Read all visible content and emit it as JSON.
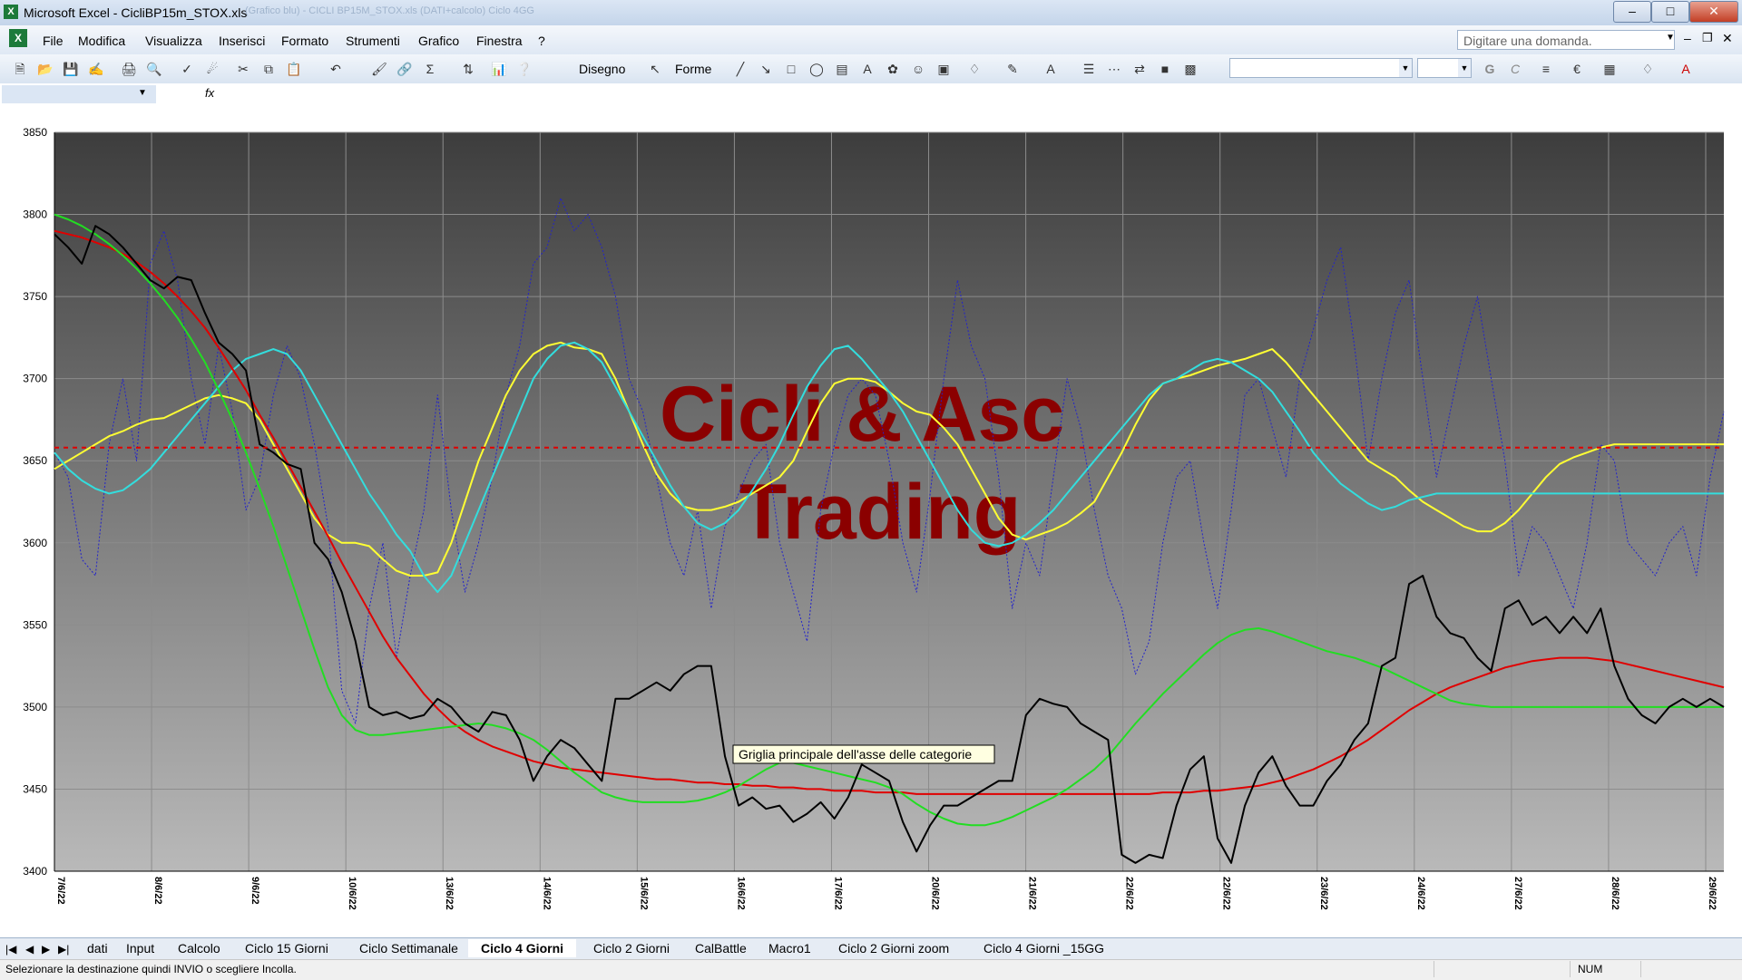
{
  "window": {
    "app_icon": "excel-icon",
    "title": "Microsoft Excel - CicliBP15m_STOX.xls",
    "blurred_text": "(Grafico blu) - CICLI BP15M_STOX.xls (DATI+calcolo) Ciclo 4GG"
  },
  "menu": [
    "File",
    "Modifica",
    "Visualizza",
    "Inserisci",
    "Formato",
    "Strumenti",
    "Grafico",
    "Finestra",
    "?"
  ],
  "ask_box": {
    "placeholder": "Digitare una domanda."
  },
  "toolbar": {
    "disegno_label": "Disegno",
    "forme_label": "Forme"
  },
  "chart_data": {
    "type": "line",
    "watermark": [
      "Cicli & Asc",
      "Trading"
    ],
    "ylim": [
      3400,
      3850
    ],
    "yticks": [
      3400,
      3450,
      3500,
      3550,
      3600,
      3650,
      3700,
      3750,
      3800,
      3850
    ],
    "x_labels": [
      "7/6/22",
      "8/6/22",
      "9/6/22",
      "10/6/22",
      "13/6/22",
      "14/6/22",
      "15/6/22",
      "16/6/22",
      "17/6/22",
      "20/6/22",
      "21/6/22",
      "22/6/22",
      "22/6/22",
      "23/6/22",
      "24/6/22",
      "27/6/22",
      "28/6/22",
      "29/6/22"
    ],
    "reference_line": {
      "value": 3658,
      "color": "#e00000",
      "style": "dashed"
    },
    "tooltip": "Griglia principale dell'asse delle categorie",
    "colors": {
      "price": "#000000",
      "red": "#e00000",
      "green": "#22dd22",
      "yellow": "#ffff33",
      "cyan": "#33dddd",
      "oscillator": "#2222cc"
    },
    "series": [
      {
        "key": "price",
        "values": [
          3788,
          3780,
          3770,
          3793,
          3788,
          3780,
          3770,
          3760,
          3755,
          3762,
          3760,
          3740,
          3722,
          3715,
          3705,
          3660,
          3655,
          3648,
          3645,
          3600,
          3590,
          3570,
          3540,
          3500,
          3495,
          3497,
          3493,
          3495,
          3505,
          3500,
          3490,
          3485,
          3497,
          3495,
          3480,
          3455,
          3470,
          3480,
          3475,
          3465,
          3455,
          3505,
          3505,
          3510,
          3515,
          3510,
          3520,
          3525,
          3525,
          3470,
          3440,
          3445,
          3438,
          3440,
          3430,
          3435,
          3442,
          3432,
          3445,
          3465,
          3460,
          3455,
          3430,
          3412,
          3428,
          3440,
          3440,
          3445,
          3450,
          3455,
          3455,
          3495,
          3505,
          3502,
          3500,
          3490,
          3485,
          3480,
          3410,
          3405,
          3410,
          3408,
          3440,
          3462,
          3470,
          3420,
          3405,
          3440,
          3460,
          3470,
          3452,
          3440,
          3440,
          3455,
          3465,
          3480,
          3490,
          3525,
          3530,
          3575,
          3580,
          3555,
          3545,
          3542,
          3530,
          3522,
          3560,
          3565,
          3550,
          3555,
          3545,
          3555,
          3545,
          3560,
          3525,
          3505,
          3495,
          3490,
          3500,
          3505,
          3500,
          3505,
          3500
        ]
      },
      {
        "key": "red",
        "values": [
          3790,
          3788,
          3786,
          3783,
          3780,
          3776,
          3771,
          3765,
          3758,
          3750,
          3741,
          3731,
          3719,
          3706,
          3693,
          3678,
          3664,
          3649,
          3634,
          3619,
          3604,
          3588,
          3573,
          3558,
          3543,
          3530,
          3519,
          3508,
          3499,
          3491,
          3485,
          3480,
          3476,
          3473,
          3470,
          3467,
          3465,
          3463,
          3462,
          3461,
          3460,
          3459,
          3458,
          3457,
          3456,
          3456,
          3455,
          3454,
          3454,
          3453,
          3453,
          3452,
          3452,
          3451,
          3451,
          3450,
          3450,
          3449,
          3449,
          3449,
          3448,
          3448,
          3448,
          3447,
          3447,
          3447,
          3447,
          3447,
          3447,
          3447,
          3447,
          3447,
          3447,
          3447,
          3447,
          3447,
          3447,
          3447,
          3447,
          3447,
          3447,
          3448,
          3448,
          3448,
          3449,
          3449,
          3450,
          3451,
          3452,
          3454,
          3456,
          3459,
          3462,
          3466,
          3470,
          3475,
          3480,
          3486,
          3492,
          3498,
          3503,
          3508,
          3512,
          3515,
          3518,
          3521,
          3524,
          3526,
          3528,
          3529,
          3530,
          3530,
          3530,
          3529,
          3528,
          3526,
          3524,
          3522,
          3520,
          3518,
          3516,
          3514,
          3512
        ]
      },
      {
        "key": "green",
        "values": [
          3800,
          3797,
          3793,
          3788,
          3782,
          3775,
          3767,
          3758,
          3748,
          3737,
          3724,
          3710,
          3693,
          3675,
          3655,
          3633,
          3610,
          3585,
          3560,
          3535,
          3512,
          3495,
          3486,
          3483,
          3483,
          3484,
          3485,
          3486,
          3487,
          3488,
          3489,
          3490,
          3489,
          3487,
          3484,
          3480,
          3474,
          3467,
          3460,
          3454,
          3448,
          3445,
          3443,
          3442,
          3442,
          3442,
          3442,
          3443,
          3445,
          3448,
          3452,
          3457,
          3462,
          3466,
          3466,
          3464,
          3462,
          3460,
          3458,
          3456,
          3454,
          3451,
          3447,
          3441,
          3436,
          3432,
          3429,
          3428,
          3428,
          3430,
          3433,
          3437,
          3441,
          3445,
          3450,
          3456,
          3462,
          3470,
          3480,
          3490,
          3499,
          3508,
          3516,
          3524,
          3532,
          3539,
          3544,
          3547,
          3548,
          3546,
          3543,
          3540,
          3537,
          3534,
          3532,
          3530,
          3527,
          3524,
          3520,
          3516,
          3512,
          3508,
          3504,
          3502,
          3501,
          3500,
          3500,
          3500,
          3500,
          3500,
          3500,
          3500,
          3500,
          3500,
          3500,
          3500,
          3500,
          3500,
          3500,
          3500,
          3500,
          3500,
          3500
        ]
      },
      {
        "key": "yellow",
        "values": [
          3645,
          3650,
          3655,
          3660,
          3665,
          3668,
          3672,
          3675,
          3676,
          3680,
          3684,
          3688,
          3690,
          3688,
          3685,
          3675,
          3660,
          3645,
          3630,
          3615,
          3605,
          3600,
          3600,
          3598,
          3590,
          3583,
          3580,
          3580,
          3582,
          3600,
          3625,
          3650,
          3670,
          3690,
          3705,
          3715,
          3720,
          3722,
          3719,
          3718,
          3715,
          3700,
          3680,
          3660,
          3642,
          3630,
          3622,
          3620,
          3620,
          3622,
          3625,
          3630,
          3635,
          3640,
          3650,
          3668,
          3685,
          3697,
          3700,
          3700,
          3698,
          3692,
          3685,
          3680,
          3678,
          3670,
          3660,
          3645,
          3630,
          3615,
          3605,
          3602,
          3605,
          3608,
          3612,
          3618,
          3625,
          3640,
          3655,
          3672,
          3687,
          3697,
          3700,
          3702,
          3705,
          3708,
          3710,
          3712,
          3715,
          3718,
          3710,
          3700,
          3690,
          3680,
          3670,
          3660,
          3650,
          3645,
          3640,
          3632,
          3625,
          3620,
          3615,
          3610,
          3607,
          3607,
          3612,
          3620,
          3630,
          3640,
          3648,
          3652,
          3655,
          3658,
          3660,
          3660,
          3660,
          3660,
          3660,
          3660,
          3660,
          3660,
          3660
        ]
      },
      {
        "key": "cyan",
        "values": [
          3655,
          3645,
          3638,
          3633,
          3630,
          3632,
          3638,
          3645,
          3655,
          3665,
          3675,
          3685,
          3695,
          3705,
          3712,
          3715,
          3718,
          3715,
          3705,
          3690,
          3675,
          3660,
          3645,
          3630,
          3618,
          3605,
          3595,
          3580,
          3570,
          3580,
          3600,
          3620,
          3640,
          3660,
          3680,
          3700,
          3712,
          3720,
          3722,
          3718,
          3710,
          3695,
          3680,
          3665,
          3650,
          3635,
          3622,
          3612,
          3608,
          3612,
          3620,
          3632,
          3645,
          3660,
          3678,
          3695,
          3708,
          3718,
          3720,
          3712,
          3702,
          3692,
          3680,
          3665,
          3650,
          3635,
          3620,
          3608,
          3600,
          3598,
          3600,
          3605,
          3612,
          3620,
          3630,
          3640,
          3650,
          3660,
          3670,
          3680,
          3690,
          3697,
          3700,
          3705,
          3710,
          3712,
          3710,
          3705,
          3700,
          3692,
          3680,
          3668,
          3655,
          3645,
          3636,
          3630,
          3624,
          3620,
          3622,
          3626,
          3628,
          3630,
          3630,
          3630,
          3630,
          3630,
          3630,
          3630,
          3630,
          3630,
          3630,
          3630,
          3630,
          3630,
          3630,
          3630,
          3630,
          3630,
          3630,
          3630,
          3630,
          3630,
          3630
        ]
      },
      {
        "key": "oscillator",
        "values": [
          3655,
          3640,
          3590,
          3580,
          3660,
          3700,
          3650,
          3770,
          3790,
          3760,
          3700,
          3660,
          3720,
          3680,
          3620,
          3640,
          3690,
          3720,
          3700,
          3660,
          3610,
          3510,
          3490,
          3560,
          3600,
          3530,
          3580,
          3620,
          3690,
          3620,
          3570,
          3600,
          3640,
          3690,
          3720,
          3770,
          3780,
          3810,
          3790,
          3800,
          3780,
          3750,
          3700,
          3680,
          3640,
          3600,
          3580,
          3620,
          3560,
          3610,
          3630,
          3650,
          3660,
          3600,
          3570,
          3540,
          3620,
          3660,
          3690,
          3700,
          3690,
          3650,
          3600,
          3570,
          3630,
          3700,
          3760,
          3720,
          3700,
          3640,
          3560,
          3600,
          3580,
          3640,
          3700,
          3670,
          3620,
          3580,
          3560,
          3520,
          3540,
          3600,
          3640,
          3650,
          3600,
          3560,
          3620,
          3690,
          3700,
          3670,
          3640,
          3700,
          3730,
          3760,
          3780,
          3720,
          3650,
          3700,
          3740,
          3760,
          3700,
          3640,
          3680,
          3720,
          3750,
          3700,
          3650,
          3580,
          3610,
          3600,
          3580,
          3560,
          3600,
          3660,
          3650,
          3600,
          3590,
          3580,
          3600,
          3610,
          3580,
          3640,
          3680
        ]
      }
    ]
  },
  "sheet_tabs": [
    "dati",
    "Input",
    "Calcolo",
    "Ciclo 15 Giorni",
    "Ciclo Settimanale",
    "Ciclo 4 Giorni",
    "Ciclo 2 Giorni",
    "CalBattle",
    "Macro1",
    "Ciclo 2 Giorni zoom",
    "Ciclo 4 Giorni _15GG"
  ],
  "active_tab": "Ciclo 4 Giorni",
  "status": {
    "text": "Selezionare la destinazione quindi INVIO o scegliere Incolla.",
    "num": "NUM"
  }
}
